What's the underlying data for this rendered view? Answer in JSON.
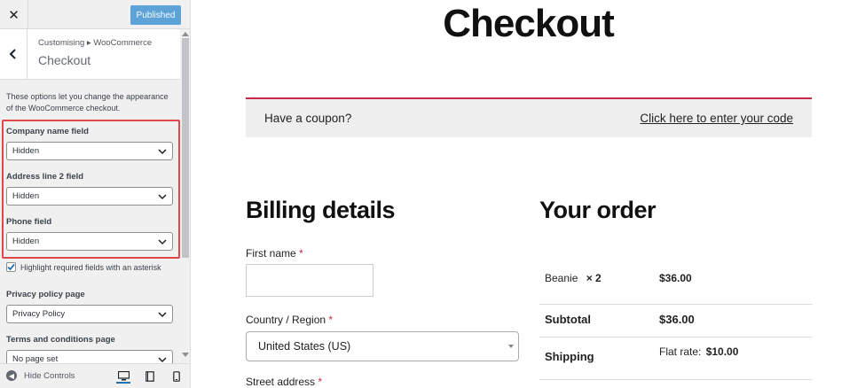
{
  "sidebar": {
    "close_icon": "close-icon",
    "publish_label": "Published",
    "breadcrumb": "Customising ▸ WooCommerce",
    "section_title": "Checkout",
    "description": "These options let you change the appearance of the WooCommerce checkout.",
    "fields": [
      {
        "label": "Company name field",
        "value": "Hidden"
      },
      {
        "label": "Address line 2 field",
        "value": "Hidden"
      },
      {
        "label": "Phone field",
        "value": "Hidden"
      }
    ],
    "highlight_required_label": "Highlight required fields with an asterisk",
    "highlight_required_checked": true,
    "privacy_policy": {
      "label": "Privacy policy page",
      "value": "Privacy Policy"
    },
    "terms": {
      "label": "Terms and conditions page",
      "value": "No page set"
    },
    "hide_controls_label": "Hide Controls",
    "accent_color": "#2271b1",
    "highlight_color": "#e04848"
  },
  "preview": {
    "page_title": "Checkout",
    "coupon_text": "Have a coupon?",
    "coupon_link": "Click here to enter your code",
    "billing_title": "Billing details",
    "first_name_label": "First name",
    "country_label": "Country / Region",
    "country_value": "United States (US)",
    "street_label": "Street address",
    "required_mark": "*",
    "order_title": "Your order",
    "order": {
      "item_name": "Beanie",
      "item_qty": "× 2",
      "item_total": "$36.00",
      "subtotal_label": "Subtotal",
      "subtotal_value": "$36.00",
      "shipping_label": "Shipping",
      "shipping_method": "Flat rate:",
      "shipping_value": "$10.00"
    },
    "accent_color": "#c8284c"
  }
}
